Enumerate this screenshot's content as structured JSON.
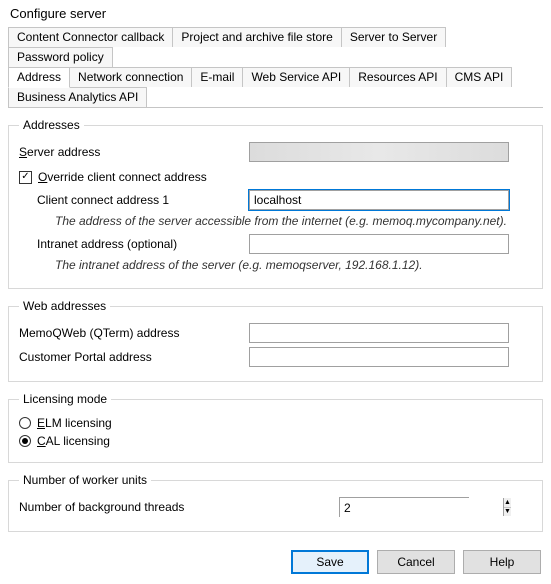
{
  "window": {
    "title": "Configure server"
  },
  "tabs_row1": [
    {
      "label": "Content Connector callback"
    },
    {
      "label": "Project and archive file store"
    },
    {
      "label": "Server to Server"
    },
    {
      "label": "Password policy"
    }
  ],
  "tabs_row2": [
    {
      "label": "Address",
      "active": true
    },
    {
      "label": "Network connection"
    },
    {
      "label": "E-mail"
    },
    {
      "label": "Web Service API"
    },
    {
      "label": "Resources API"
    },
    {
      "label": "CMS API"
    },
    {
      "label": "Business Analytics API"
    }
  ],
  "addresses": {
    "legend": "Addresses",
    "server_address_label_pre": "S",
    "server_address_label_post": "erver address",
    "server_address_value": "",
    "override_checked": true,
    "override_label_pre": "O",
    "override_label_post": "verride client connect address",
    "client_connect_label": "Client connect address 1",
    "client_connect_value": "localhost",
    "client_connect_hint": "The address of the server accessible from the internet (e.g. memoq.mycompany.net).",
    "intranet_label": "Intranet address (optional)",
    "intranet_value": "",
    "intranet_hint": "The intranet address of the server (e.g. memoqserver, 192.168.1.12)."
  },
  "web": {
    "legend": "Web addresses",
    "memoqweb_label": "MemoQWeb (QTerm) address",
    "memoqweb_value": "",
    "portal_label": "Customer Portal address",
    "portal_value": ""
  },
  "licensing": {
    "legend": "Licensing mode",
    "elm_pre": "E",
    "elm_post": "LM licensing",
    "elm_selected": false,
    "cal_pre": "C",
    "cal_post": "AL licensing",
    "cal_selected": true
  },
  "worker": {
    "legend": "Number of worker units",
    "threads_label": "Number of background threads",
    "threads_value": "2"
  },
  "buttons": {
    "save": "Save",
    "cancel": "Cancel",
    "help": "Help"
  }
}
